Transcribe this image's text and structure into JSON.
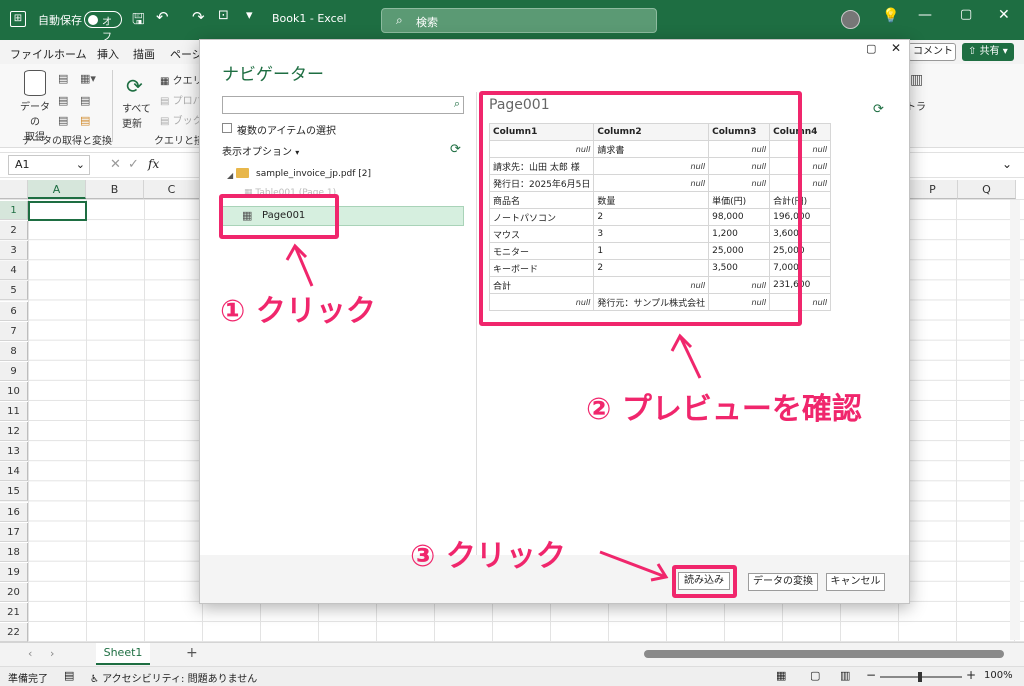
{
  "titlebar": {
    "autosave_label": "自動保存",
    "autosave_state": "オフ",
    "doc_title": "Book1 - Excel",
    "search_placeholder": "検索"
  },
  "menu": [
    "ファイル",
    "ホーム",
    "挿入",
    "描画",
    "ページ"
  ],
  "menu_right": {
    "comment": "コメント",
    "share": "共有"
  },
  "ribbon": {
    "get_data": "データの\n取得",
    "get_data_group": "データの取得と変換",
    "refresh_all": "すべて\n更新",
    "query_group": "クエリと接続",
    "query_item": "クエリと",
    "property_item": "プロパ",
    "book_item": "ブックの",
    "right_label": "トラ"
  },
  "namebox": "A1",
  "fx": "fx",
  "columns": [
    "A",
    "B",
    "C",
    "P",
    "Q"
  ],
  "rows": [
    "1",
    "2",
    "3",
    "4",
    "5",
    "6",
    "7",
    "8",
    "9",
    "10",
    "11",
    "12",
    "13",
    "14",
    "15",
    "16",
    "17",
    "18",
    "19",
    "20",
    "21",
    "22"
  ],
  "sheet_tab": "Sheet1",
  "status": {
    "ready": "準備完了",
    "accessibility": "アクセシビリティ: 問題ありません",
    "zoom": "100%"
  },
  "navigator": {
    "title": "ナビゲーター",
    "multi_select": "複数のアイテムの選択",
    "display_options": "表示オプション",
    "file": "sample_invoice_jp.pdf [2]",
    "item_partial": "Table001 (Page 1)",
    "selected_item": "Page001",
    "preview_title": "Page001",
    "preview": {
      "headers": [
        "Column1",
        "Column2",
        "Column3",
        "Column4"
      ],
      "rows": [
        [
          "null",
          "請求書",
          "null",
          "null"
        ],
        [
          "請求先：山田 太郎 様",
          "null",
          "null",
          "null"
        ],
        [
          "発行日：2025年6月5日",
          "null",
          "null",
          "null"
        ],
        [
          "商品名",
          "数量",
          "単価(円)",
          "合計(円)"
        ],
        [
          "ノートパソコン",
          "2",
          "98,000",
          "196,000"
        ],
        [
          "マウス",
          "3",
          "1,200",
          "3,600"
        ],
        [
          "モニター",
          "1",
          "25,000",
          "25,000"
        ],
        [
          "キーボード",
          "2",
          "3,500",
          "7,000"
        ],
        [
          "合計",
          "null",
          "null",
          "231,600"
        ],
        [
          "null",
          "発行元：サンプル株式会社",
          "null",
          "null"
        ]
      ]
    },
    "load_button": "読み込み",
    "transform_button": "データの変換",
    "cancel_button": "キャンセル"
  },
  "annotations": {
    "step1": "① クリック",
    "step2": "② プレビューを確認",
    "step3": "③ クリック"
  },
  "colors": {
    "excel_green": "#1e6e42",
    "highlight": "#f0266c",
    "selected_bg": "#d6efdf"
  }
}
